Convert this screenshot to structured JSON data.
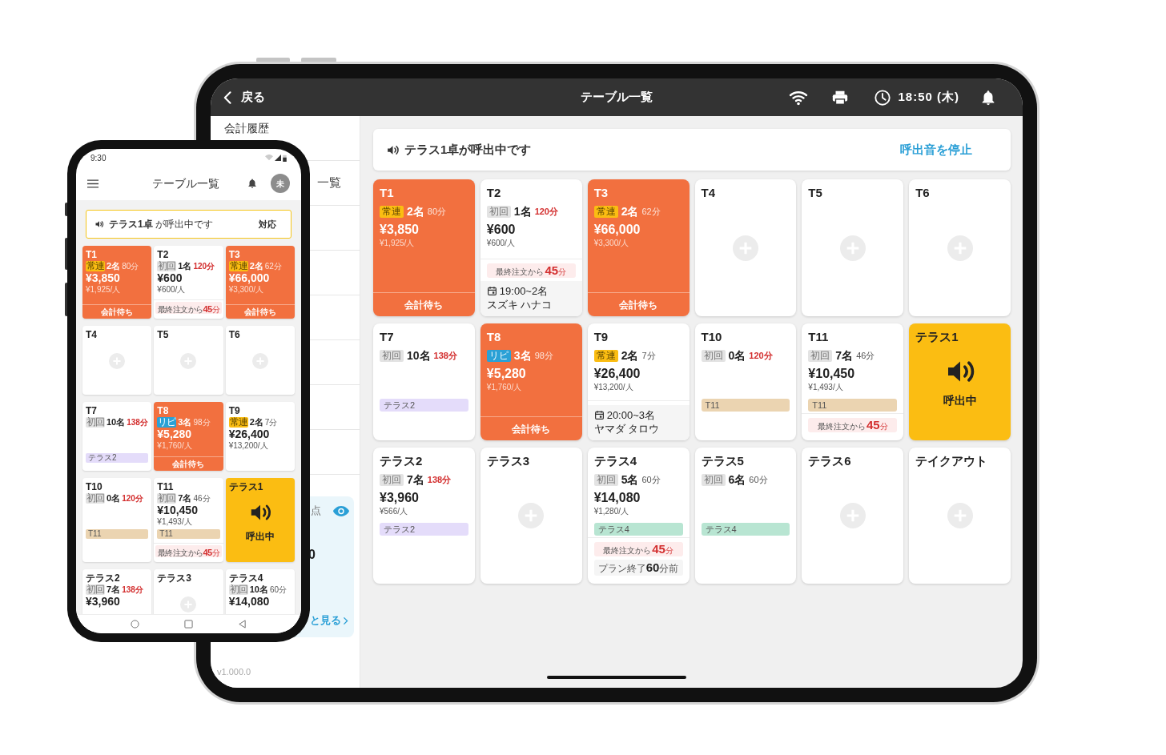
{
  "tablet": {
    "top_bar": {
      "back": "戻る",
      "title": "テーブル一覧",
      "clock": "18:50 (木)"
    },
    "sidebar": {
      "items": [
        "会計履歴",
        "一覧"
      ],
      "summary": {
        "label": "点",
        "value": "0",
        "link": "と見る"
      },
      "version": "v1.000.0"
    },
    "banner": {
      "message": "テラス1卓が呼出中です",
      "action": "呼出音を停止"
    },
    "tables": [
      {
        "name": "T1",
        "kind": "billing",
        "badge": {
          "label": "常連",
          "kind": "regular"
        },
        "guests": "2名",
        "minutes": "80分",
        "overdue": false,
        "total": "¥3,850",
        "per_person": "¥1,925/人",
        "footer": "会計待ち"
      },
      {
        "name": "T2",
        "kind": "seated",
        "badge": {
          "label": "初回",
          "kind": "first"
        },
        "guests": "1名",
        "minutes": "120分",
        "overdue": true,
        "total": "¥600",
        "per_person": "¥600/人",
        "last_order": {
          "label": "最終注文から",
          "value": "45",
          "unit": "分"
        },
        "reservation": {
          "time": "19:00~2名",
          "name": "スズキ ハナコ"
        }
      },
      {
        "name": "T3",
        "kind": "billing",
        "badge": {
          "label": "常連",
          "kind": "regular"
        },
        "guests": "2名",
        "minutes": "62分",
        "overdue": false,
        "total": "¥66,000",
        "per_person": "¥3,300/人",
        "footer": "会計待ち"
      },
      {
        "name": "T4",
        "kind": "empty"
      },
      {
        "name": "T5",
        "kind": "empty"
      },
      {
        "name": "T6",
        "kind": "empty"
      },
      {
        "name": "T7",
        "kind": "seated",
        "badge": {
          "label": "初回",
          "kind": "first"
        },
        "guests": "10名",
        "minutes": "138分",
        "overdue": true,
        "tag": {
          "label": "テラス2",
          "color": "#e4dcfa"
        }
      },
      {
        "name": "T8",
        "kind": "billing",
        "badge": {
          "label": "リピ",
          "kind": "repeat"
        },
        "guests": "3名",
        "minutes": "98分",
        "overdue": false,
        "total": "¥5,280",
        "per_person": "¥1,760/人",
        "footer": "会計待ち"
      },
      {
        "name": "T9",
        "kind": "seated",
        "badge": {
          "label": "常連",
          "kind": "regular"
        },
        "guests": "2名",
        "minutes": "7分",
        "overdue": false,
        "total": "¥26,400",
        "per_person": "¥13,200/人",
        "reservation": {
          "time": "20:00~3名",
          "name": "ヤマダ タロウ"
        }
      },
      {
        "name": "T10",
        "kind": "seated",
        "badge": {
          "label": "初回",
          "kind": "first"
        },
        "guests": "0名",
        "minutes": "120分",
        "overdue": true,
        "tag": {
          "label": "T11",
          "color": "#ebd4b1"
        }
      },
      {
        "name": "T11",
        "kind": "seated",
        "badge": {
          "label": "初回",
          "kind": "first"
        },
        "guests": "7名",
        "minutes": "46分",
        "overdue": false,
        "total": "¥10,450",
        "per_person": "¥1,493/人",
        "tag": {
          "label": "T11",
          "color": "#ebd4b1"
        },
        "last_order": {
          "label": "最終注文から",
          "value": "45",
          "unit": "分"
        }
      },
      {
        "name": "テラス1",
        "kind": "calling",
        "call_label": "呼出中"
      },
      {
        "name": "テラス2",
        "kind": "seated",
        "badge": {
          "label": "初回",
          "kind": "first"
        },
        "guests": "7名",
        "minutes": "138分",
        "overdue": true,
        "total": "¥3,960",
        "per_person": "¥566/人",
        "tag": {
          "label": "テラス2",
          "color": "#e4dcfa"
        }
      },
      {
        "name": "テラス3",
        "kind": "empty"
      },
      {
        "name": "テラス4",
        "kind": "seated",
        "badge": {
          "label": "初回",
          "kind": "first"
        },
        "guests": "5名",
        "minutes": "60分",
        "overdue": false,
        "total": "¥14,080",
        "per_person": "¥1,280/人",
        "tag": {
          "label": "テラス4",
          "color": "#b8e5d2"
        },
        "last_order": {
          "label": "最終注文から",
          "value": "45",
          "unit": "分"
        },
        "plan_end": {
          "label": "プラン終了",
          "value": "60",
          "unit": "分前"
        }
      },
      {
        "name": "テラス5",
        "kind": "seated",
        "badge": {
          "label": "初回",
          "kind": "first"
        },
        "guests": "6名",
        "minutes": "60分",
        "overdue": false,
        "tag": {
          "label": "テラス4",
          "color": "#b8e5d2"
        }
      },
      {
        "name": "テラス6",
        "kind": "empty"
      },
      {
        "name": "テイクアウト",
        "kind": "empty"
      }
    ]
  },
  "phone": {
    "status_time": "9:30",
    "title": "テーブル一覧",
    "avatar": "未",
    "banner": {
      "message": "**テラス1卓** が呼出中です",
      "action": "対応"
    },
    "tables": [
      {
        "name": "T1",
        "kind": "billing",
        "badge": {
          "label": "常連",
          "kind": "regular"
        },
        "guests": "2名",
        "minutes": "80分",
        "overdue": false,
        "total": "¥3,850",
        "per_person": "¥1,925/人",
        "footer": "会計待ち"
      },
      {
        "name": "T2",
        "kind": "seated",
        "badge": {
          "label": "初回",
          "kind": "first"
        },
        "guests": "1名",
        "minutes": "120分",
        "overdue": true,
        "total": "¥600",
        "per_person": "¥600/人",
        "last_order": {
          "label": "最終注文から",
          "value": "45",
          "unit": "分"
        }
      },
      {
        "name": "T3",
        "kind": "billing",
        "badge": {
          "label": "常連",
          "kind": "regular"
        },
        "guests": "2名",
        "minutes": "62分",
        "overdue": false,
        "total": "¥66,000",
        "per_person": "¥3,300/人",
        "footer": "会計待ち"
      },
      {
        "name": "T4",
        "kind": "empty"
      },
      {
        "name": "T5",
        "kind": "empty"
      },
      {
        "name": "T6",
        "kind": "empty"
      },
      {
        "name": "T7",
        "kind": "seated",
        "badge": {
          "label": "初回",
          "kind": "first"
        },
        "guests": "10名",
        "minutes": "138分",
        "overdue": true,
        "tag": {
          "label": "テラス2",
          "color": "#e4dcfa"
        }
      },
      {
        "name": "T8",
        "kind": "billing",
        "badge": {
          "label": "リピ",
          "kind": "repeat"
        },
        "guests": "3名",
        "minutes": "98分",
        "overdue": false,
        "total": "¥5,280",
        "per_person": "¥1,760/人",
        "footer": "会計待ち"
      },
      {
        "name": "T9",
        "kind": "seated",
        "badge": {
          "label": "常連",
          "kind": "regular"
        },
        "guests": "2名",
        "minutes": "7分",
        "overdue": false,
        "total": "¥26,400",
        "per_person": "¥13,200/人"
      },
      {
        "name": "T10",
        "kind": "seated",
        "badge": {
          "label": "初回",
          "kind": "first"
        },
        "guests": "0名",
        "minutes": "120分",
        "overdue": true,
        "tag": {
          "label": "T11",
          "color": "#ebd4b1"
        }
      },
      {
        "name": "T11",
        "kind": "seated",
        "badge": {
          "label": "初回",
          "kind": "first"
        },
        "guests": "7名",
        "minutes": "46分",
        "overdue": false,
        "total": "¥10,450",
        "per_person": "¥1,493/人",
        "tag": {
          "label": "T11",
          "color": "#ebd4b1"
        },
        "last_order": {
          "label": "最終注文から",
          "value": "45",
          "unit": "分"
        }
      },
      {
        "name": "テラス1",
        "kind": "calling",
        "call_label": "呼出中"
      },
      {
        "name": "テラス2",
        "kind": "seated",
        "badge": {
          "label": "初回",
          "kind": "first"
        },
        "guests": "7名",
        "minutes": "138分",
        "overdue": true,
        "total": "¥3,960"
      },
      {
        "name": "テラス3",
        "kind": "empty"
      },
      {
        "name": "テラス4",
        "kind": "seated",
        "badge": {
          "label": "初回",
          "kind": "first"
        },
        "guests": "10名",
        "minutes": "60分",
        "overdue": false,
        "total": "¥14,080"
      }
    ]
  }
}
